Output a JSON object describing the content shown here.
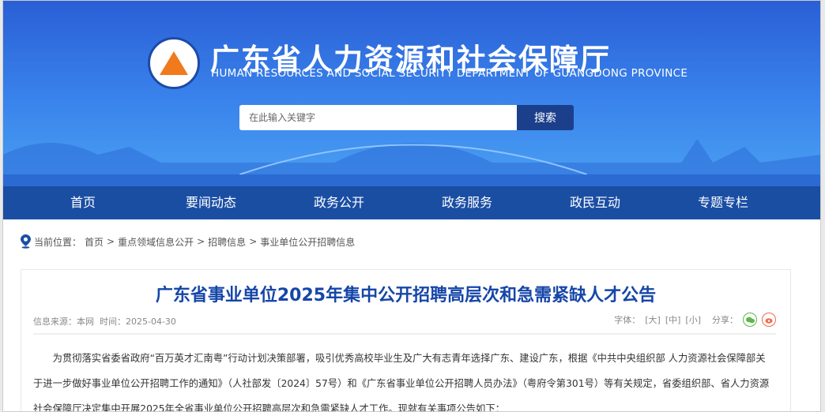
{
  "header": {
    "title_cn": "广东省人力资源和社会保障厅",
    "title_en": "HUMAN RESOURCES AND SOCIAL SECURITY DEPARTMENT OF GUANGDONG PROVINCE"
  },
  "search": {
    "placeholder": "在此输入关键字",
    "button": "搜索"
  },
  "nav": [
    "首页",
    "要闻动态",
    "政务公开",
    "政务服务",
    "政民互动",
    "专题专栏"
  ],
  "breadcrumb": {
    "label": "当前位置：",
    "items": [
      "首页",
      "重点领域信息公开",
      "招聘信息",
      "事业单位公开招聘信息"
    ],
    "sep": ">"
  },
  "article": {
    "title": "广东省事业单位2025年集中公开招聘高层次和急需紧缺人才公告",
    "source": "信息来源：本网",
    "time": "时间：2025-04-30",
    "font_label": "字体：",
    "font_sizes": [
      "[大]",
      "[中]",
      "[小]"
    ],
    "share_label": "分享：",
    "body": "为贯彻落实省委省政府“百万英才汇南粤”行动计划决策部署，吸引优秀高校毕业生及广大有志青年选择广东、建设广东，根据《中共中央组织部 人力资源社会保障部关于进一步做好事业单位公开招聘工作的通知》（人社部发〔2024〕57号）和《广东省事业单位公开招聘人员办法》（粤府令第301号）等有关规定，省委组织部、省人力资源社会保障厅决定集中开展2025年全省事业单位公开招聘高层次和急需紧缺人才工作。现就有关事项公告如下："
  }
}
